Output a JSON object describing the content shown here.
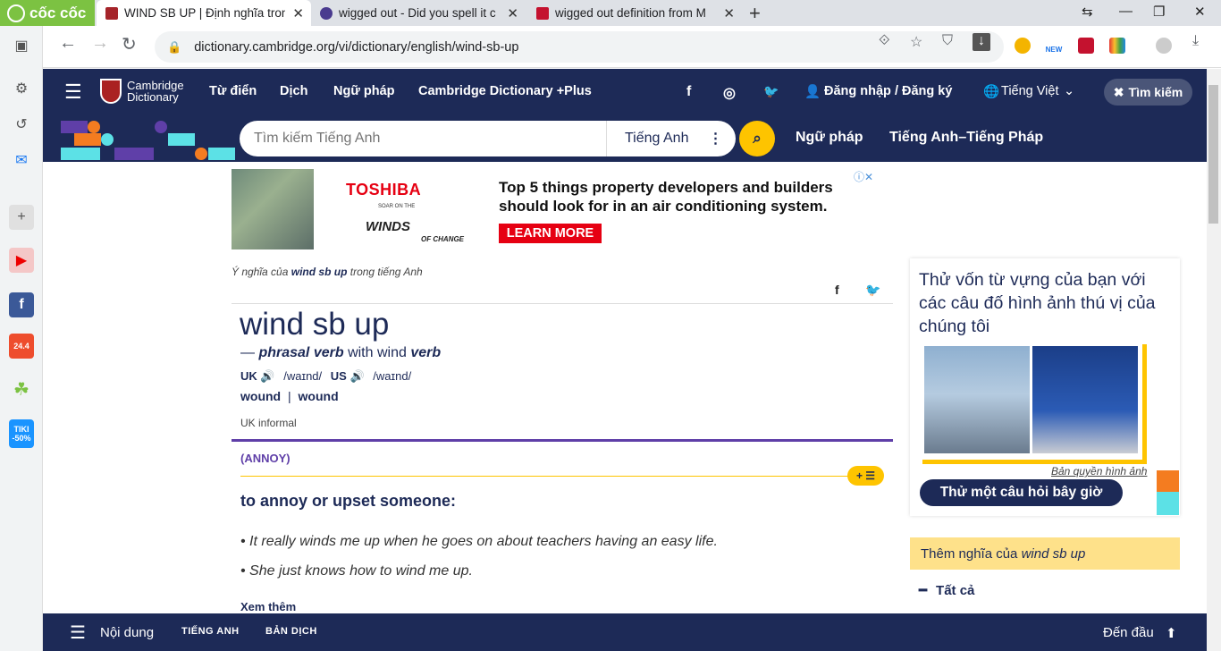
{
  "browser": {
    "brand": "cốc cốc",
    "tabs": [
      {
        "title": "WIND SB UP | Định nghĩa tron",
        "active": true
      },
      {
        "title": "wigged out - Did you spell it c",
        "active": false
      },
      {
        "title": "wigged out definition from M",
        "active": false
      }
    ],
    "url": "dictionary.cambridge.org/vi/dictionary/english/wind-sb-up",
    "new_badge": "NEW"
  },
  "sidebar": {
    "tiki_label": "TIKI -50%",
    "shopee_label": "24.4"
  },
  "site": {
    "logo_line1": "Cambridge",
    "logo_line2": "Dictionary",
    "nav": [
      "Từ điển",
      "Dịch",
      "Ngữ pháp",
      "Cambridge Dictionary +Plus"
    ],
    "login": "Đăng nhập / Đăng ký",
    "language": "Tiếng Việt",
    "search_button": "Tìm kiếm",
    "search_placeholder": "Tìm kiếm Tiếng Anh",
    "search_lang": "Tiếng Anh",
    "links": [
      "Ngữ pháp",
      "Tiếng Anh–Tiếng Pháp"
    ]
  },
  "ad": {
    "brand": "TOSHIBA",
    "tagline": "SOAR ON THE",
    "winds": "WINDS",
    "of_change": "OF CHANGE",
    "headline": "Top 5 things property developers and builders should look for in an air conditioning system.",
    "cta": "LEARN MORE"
  },
  "entry": {
    "meaning_prefix": "Ý nghĩa của",
    "meaning_word": "wind sb up",
    "meaning_suffix": "trong tiếng Anh",
    "headword": "wind sb up",
    "pos_dash": "—",
    "pos": "phrasal verb",
    "pos_with": "with wind",
    "pos_verb": "verb",
    "uk_label": "UK",
    "uk_ipa": "/waɪnd/",
    "us_label": "US",
    "us_ipa": "/waɪnd/",
    "form1": "wound",
    "form_sep": "|",
    "form2": "wound",
    "grammar": "UK informal",
    "guideword": "(ANNOY)",
    "definition": "to annoy or upset someone:",
    "examples": [
      "It really winds me up when he goes on about teachers having an easy life.",
      "She just knows how to wind me up."
    ],
    "see_more": "Xem thêm",
    "plus_icon": "+ ☰"
  },
  "right": {
    "quiz_title": "Thử vốn từ vựng của bạn với các câu đố hình ảnh thú vị của chúng tôi",
    "copyright": "Bản quyền hình ảnh",
    "quiz_button": "Thử một câu hỏi bây giờ",
    "more_prefix": "Thêm nghĩa của",
    "more_word": "wind sb up",
    "all_label": "Tất cả"
  },
  "bottom": {
    "contents": "Nội dung",
    "tab1": "TIẾNG ANH",
    "tab2": "BẢN DỊCH",
    "to_top": "Đến đầu"
  },
  "colors": {
    "navy": "#1d2a57",
    "yellow": "#fec400",
    "purple": "#5f3fa8",
    "coccoc_green": "#7cc242"
  }
}
